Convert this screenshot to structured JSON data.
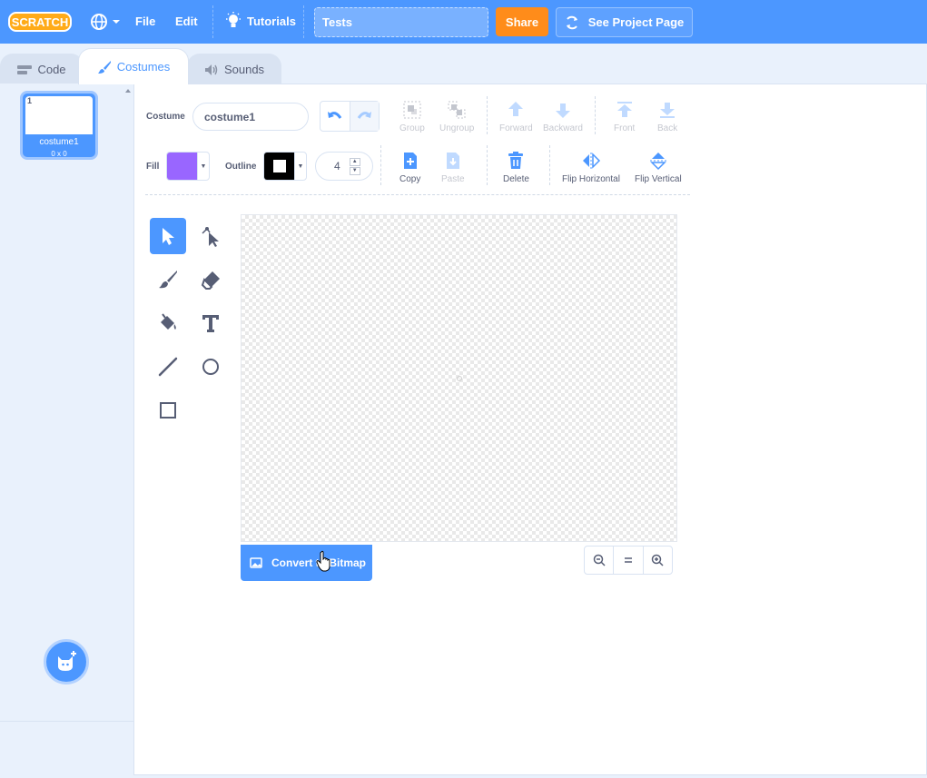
{
  "menubar": {
    "logo_text": "SCRATCH",
    "file_label": "File",
    "edit_label": "Edit",
    "tutorials_label": "Tutorials",
    "project_title": "Tests",
    "share_label": "Share",
    "see_project_label": "See Project Page"
  },
  "tabs": {
    "code_label": "Code",
    "costumes_label": "Costumes",
    "sounds_label": "Sounds",
    "active": "Costumes"
  },
  "costume_list": {
    "items": [
      {
        "number": "1",
        "name": "costume1",
        "size": "0 x 0"
      }
    ]
  },
  "toolbar": {
    "costume_label": "Costume",
    "costume_name": "costume1",
    "group_label": "Group",
    "ungroup_label": "Ungroup",
    "forward_label": "Forward",
    "backward_label": "Backward",
    "front_label": "Front",
    "back_label": "Back",
    "fill_label": "Fill",
    "fill_color": "#9966ff",
    "outline_label": "Outline",
    "outline_color": "#000000",
    "outline_width": "4",
    "copy_label": "Copy",
    "paste_label": "Paste",
    "delete_label": "Delete",
    "flip_horizontal_label": "Flip Horizontal",
    "flip_vertical_label": "Flip Vertical"
  },
  "canvas": {
    "convert_label": "Convert to Bitmap"
  },
  "colors": {
    "accent": "#4c97ff",
    "share": "#ff8c1a",
    "text": "#575e75"
  },
  "icons": {
    "tools": [
      "select-icon",
      "reshape-icon",
      "brush-icon",
      "eraser-icon",
      "fill-icon",
      "text-icon",
      "line-icon",
      "circle-icon",
      "rectangle-icon"
    ]
  }
}
